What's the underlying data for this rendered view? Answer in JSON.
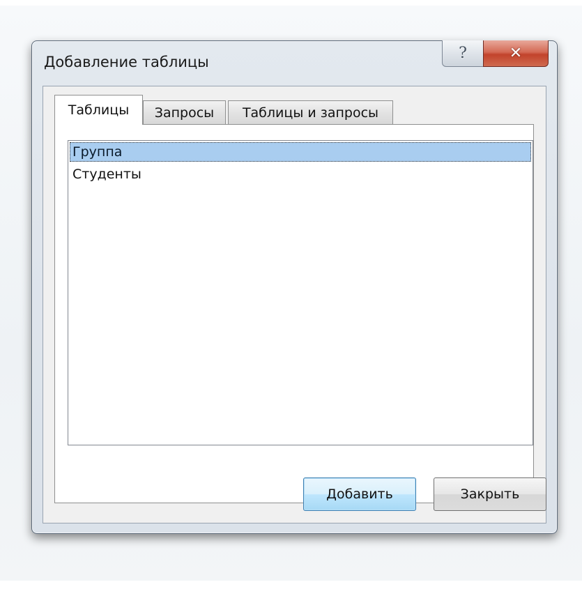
{
  "dialog": {
    "title": "Добавление таблицы",
    "help_glyph": "?",
    "close_glyph": "✕"
  },
  "tabs": [
    {
      "label": "Таблицы",
      "active": true
    },
    {
      "label": "Запросы",
      "active": false
    },
    {
      "label": "Таблицы и запросы",
      "active": false
    }
  ],
  "list": {
    "items": [
      {
        "label": "Группа",
        "selected": true
      },
      {
        "label": "Студенты",
        "selected": false
      }
    ]
  },
  "buttons": {
    "add_label": "Добавить",
    "close_label": "Закрыть"
  },
  "colors": {
    "selection": "#a9cdf0",
    "close_button": "#c2432b",
    "default_button_border": "#3c7fb1"
  }
}
